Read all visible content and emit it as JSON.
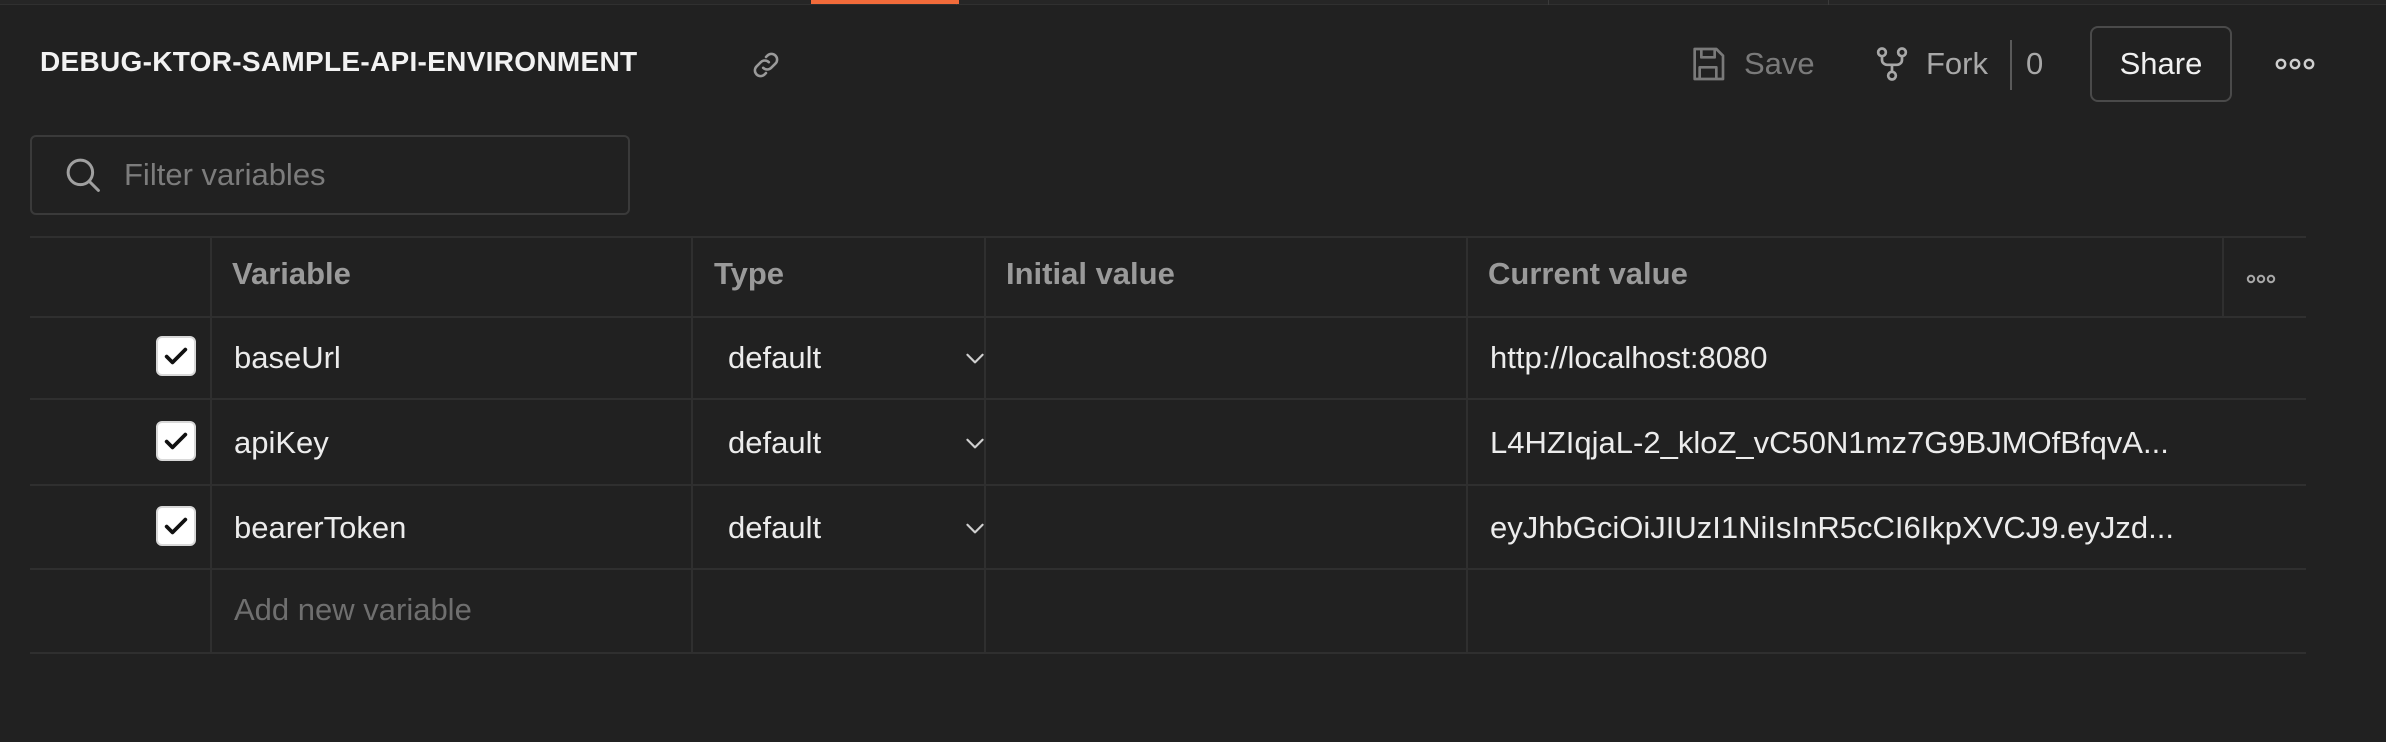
{
  "header": {
    "title": "DEBUG-KTOR-SAMPLE-API-ENVIRONMENT",
    "save_label": "Save",
    "fork_label": "Fork",
    "fork_count": "0",
    "share_label": "Share"
  },
  "filter": {
    "placeholder": "Filter variables"
  },
  "table": {
    "columns": [
      "Variable",
      "Type",
      "Initial value",
      "Current value"
    ],
    "rows": [
      {
        "checked": true,
        "variable": "baseUrl",
        "type": "default",
        "initial_value": "",
        "current_value": "http://localhost:8080"
      },
      {
        "checked": true,
        "variable": "apiKey",
        "type": "default",
        "initial_value": "",
        "current_value": "L4HZIqjaL-2_kloZ_vC50N1mz7G9BJMOfBfqvA..."
      },
      {
        "checked": true,
        "variable": "bearerToken",
        "type": "default",
        "initial_value": "",
        "current_value": "eyJhbGciOiJIUzI1NiIsInR5cCI6IkpXVCJ9.eyJzd..."
      }
    ],
    "add_placeholder": "Add new variable"
  },
  "colors": {
    "background": "#212121",
    "accent": "#f26b3a",
    "border": "#2f2f2f"
  },
  "icons": [
    "link-icon",
    "save-icon",
    "fork-icon",
    "more-icon",
    "search-icon",
    "checkmark-icon",
    "chevron-down-icon"
  ]
}
